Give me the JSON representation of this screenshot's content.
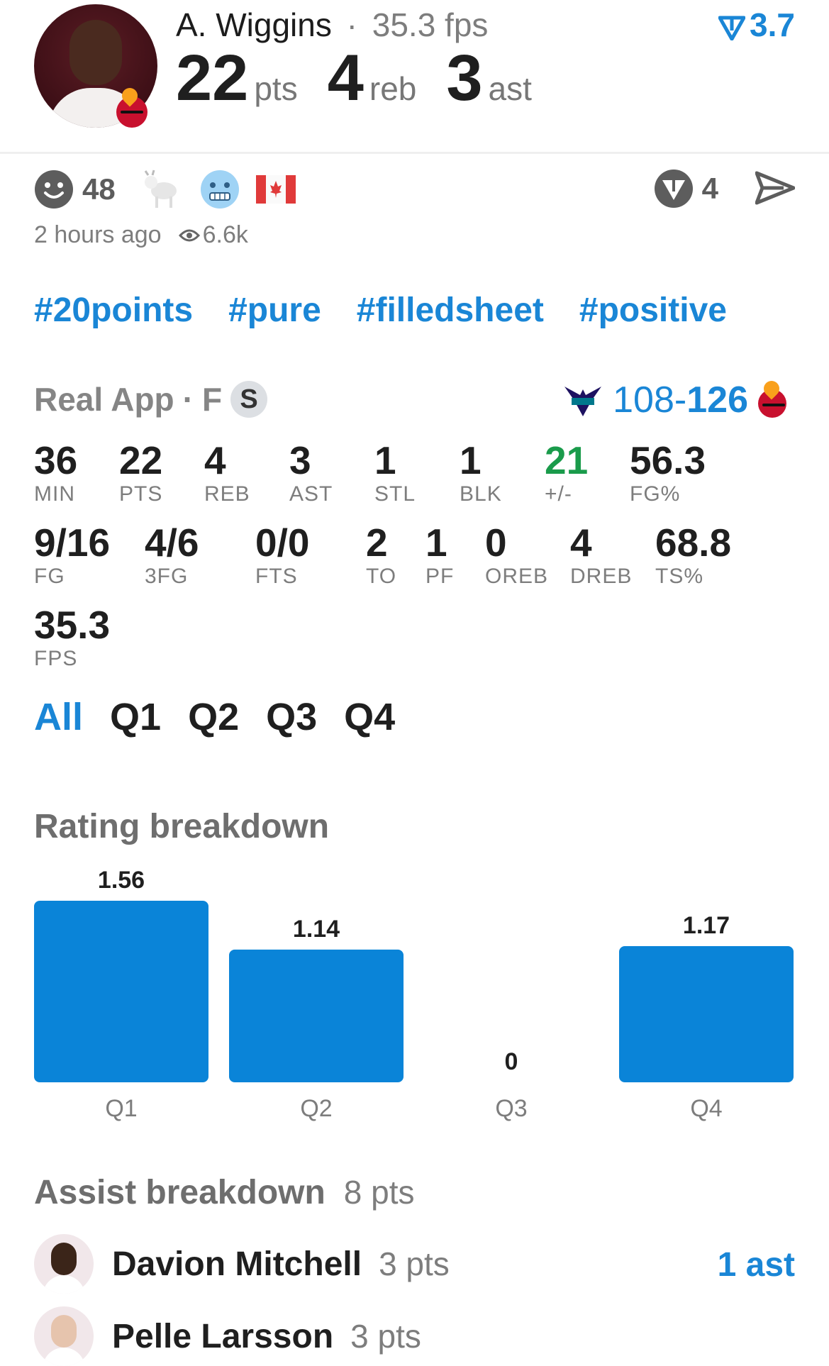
{
  "header": {
    "player_name": "A. Wiggins",
    "separator": "·",
    "fps": "35.3 fps",
    "rating": "3.7",
    "rating_icon": "vector-down-icon",
    "pts": "22",
    "pts_label": "pts",
    "reb": "4",
    "reb_label": "reb",
    "ast": "3",
    "ast_label": "ast"
  },
  "reactions": {
    "smile_count": "48",
    "icons": [
      "smile-icon",
      "goat-icon",
      "cold-face-icon",
      "canada-flag-icon"
    ],
    "vector_count": "4",
    "time": "2 hours ago",
    "views": "6.6k"
  },
  "tags": [
    "#20points",
    "#pure",
    "#filledsheet",
    "#positive"
  ],
  "source": {
    "label": "Real App",
    "sep": "·",
    "position": "F",
    "badge": "S",
    "score_a": "108",
    "dash": "-",
    "score_b": "126"
  },
  "stats_row1": [
    {
      "v": "36",
      "l": "MIN"
    },
    {
      "v": "22",
      "l": "PTS"
    },
    {
      "v": "4",
      "l": "REB"
    },
    {
      "v": "3",
      "l": "AST"
    },
    {
      "v": "1",
      "l": "STL"
    },
    {
      "v": "1",
      "l": "BLK"
    },
    {
      "v": "21",
      "l": "+/-"
    },
    {
      "v": "56.3",
      "l": "FG%"
    }
  ],
  "stats_row2": [
    {
      "v": "9/16",
      "l": "FG"
    },
    {
      "v": "4/6",
      "l": "3FG"
    },
    {
      "v": "0/0",
      "l": "FTS"
    },
    {
      "v": "2",
      "l": "TO"
    },
    {
      "v": "1",
      "l": "PF"
    },
    {
      "v": "0",
      "l": "OREB"
    },
    {
      "v": "4",
      "l": "DREB"
    },
    {
      "v": "68.8",
      "l": "TS%"
    }
  ],
  "stats_row3": [
    {
      "v": "35.3",
      "l": "FPS"
    }
  ],
  "quarter_tabs": [
    "All",
    "Q1",
    "Q2",
    "Q3",
    "Q4"
  ],
  "rating_title": "Rating breakdown",
  "chart_data": {
    "type": "bar",
    "categories": [
      "Q1",
      "Q2",
      "Q3",
      "Q4"
    ],
    "values": [
      1.56,
      1.14,
      0,
      1.17
    ],
    "title": "Rating breakdown",
    "color": "#0a84d8"
  },
  "assist": {
    "title": "Assist breakdown",
    "total": "8 pts",
    "players": [
      {
        "name": "Davion Mitchell",
        "pts": "3 pts",
        "ast": "1 ast"
      },
      {
        "name": "Pelle Larsson",
        "pts": "3 pts",
        "ast": ""
      }
    ]
  },
  "colors": {
    "accent": "#1a86d6",
    "positive": "#1a9b4b",
    "bar": "#0a84d8"
  }
}
